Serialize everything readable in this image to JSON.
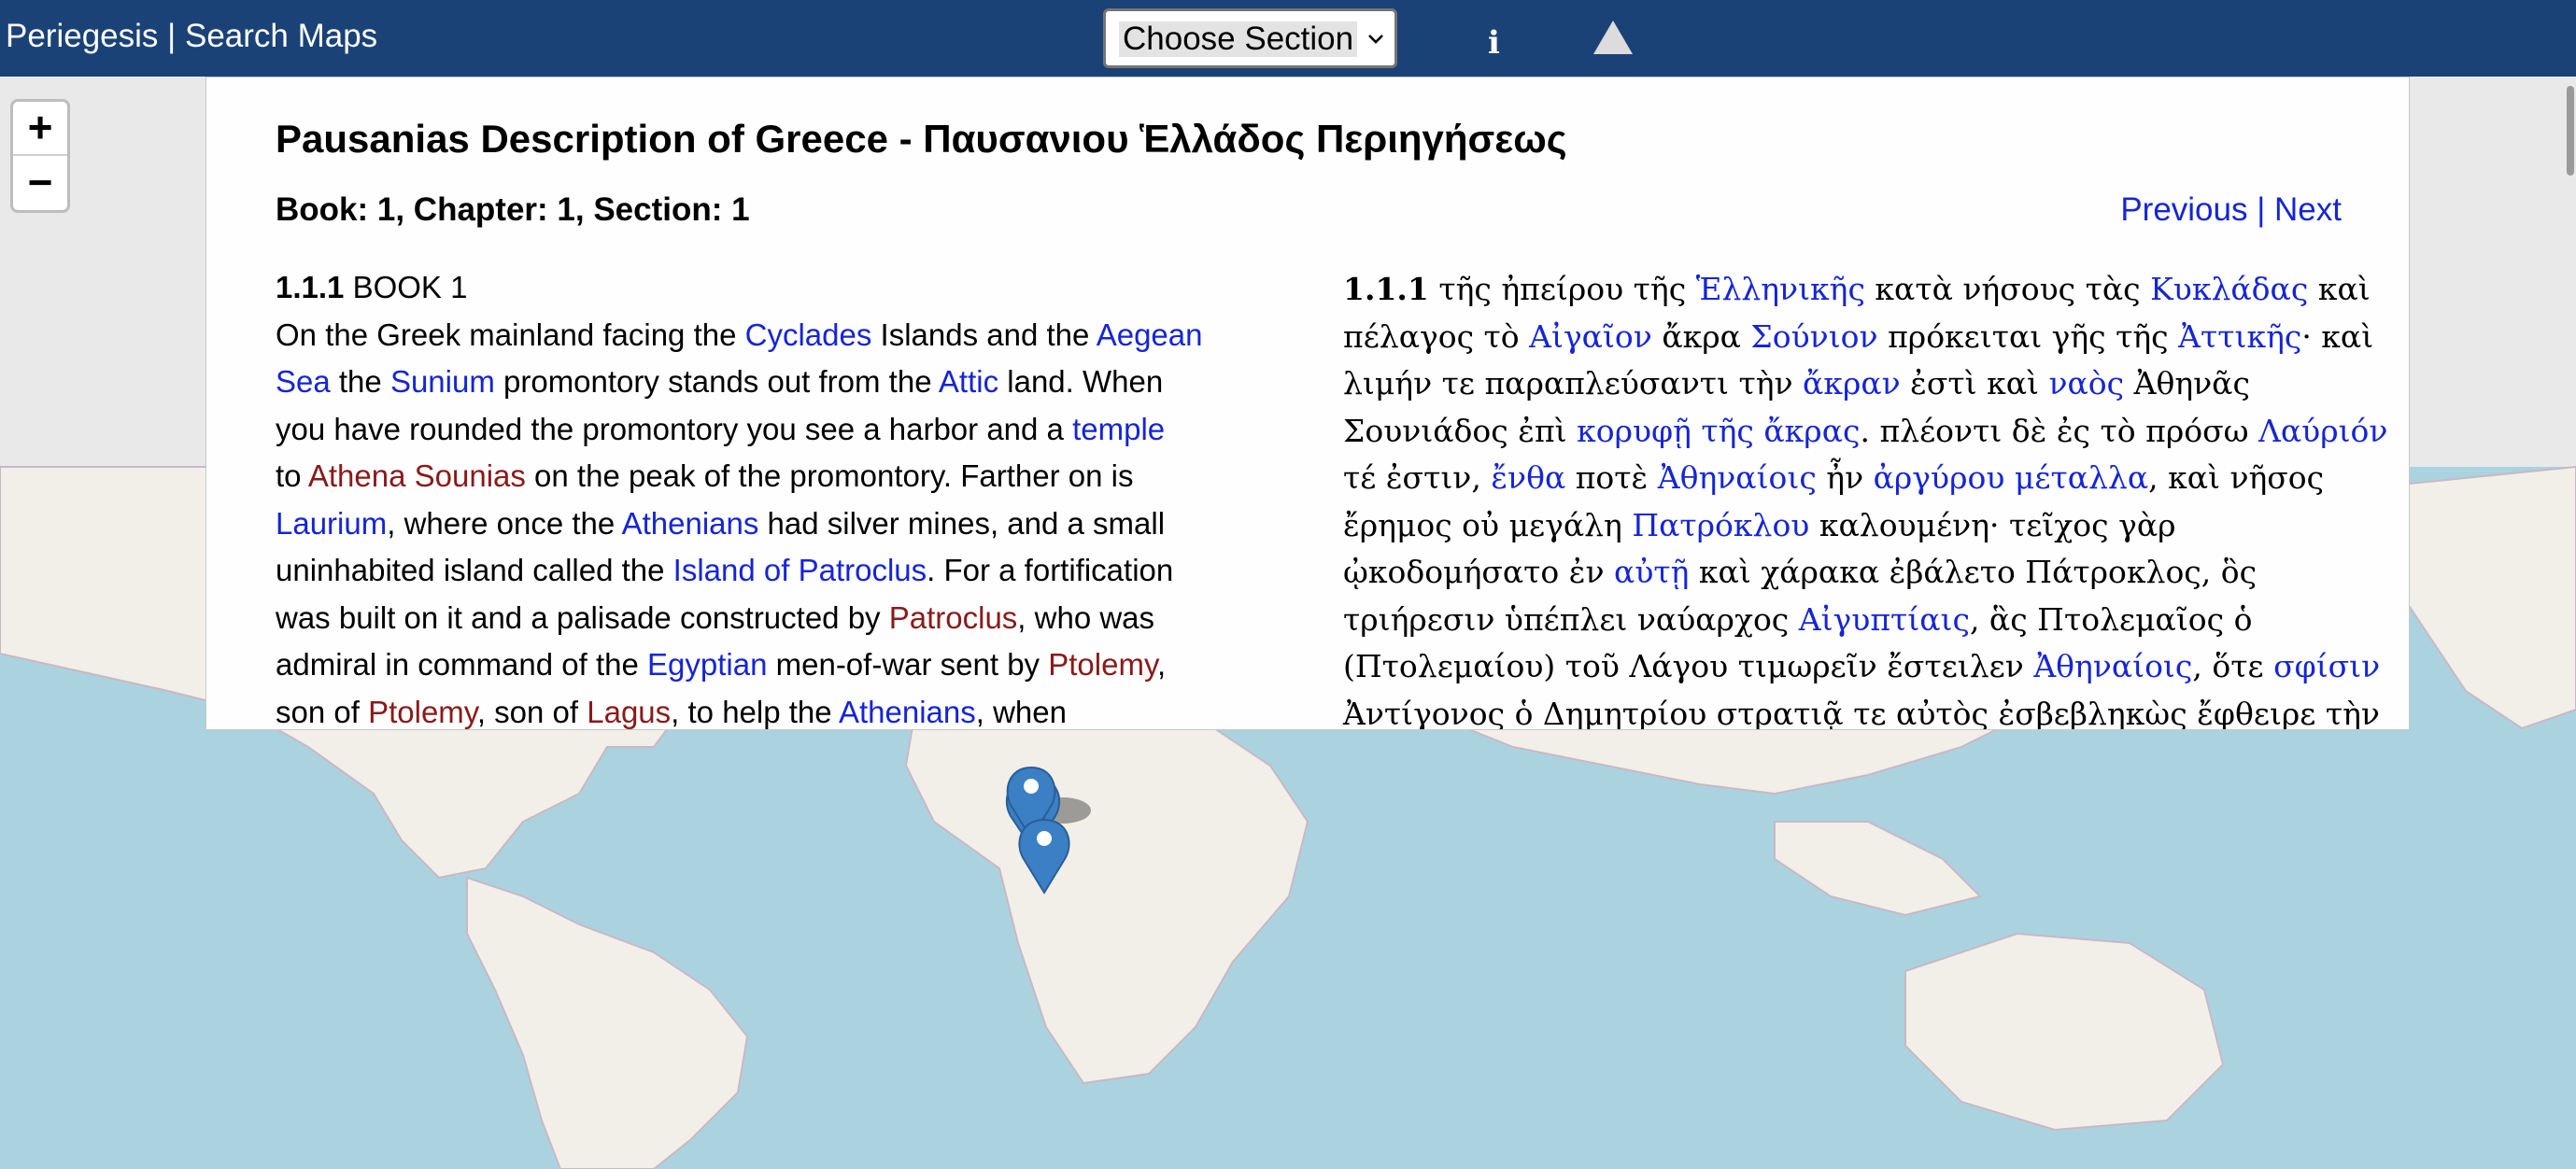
{
  "header": {
    "app_name": "Periegesis",
    "separator": " | ",
    "search_maps": "Search Maps",
    "section_select": "Choose Section",
    "info_icon": "info-icon",
    "up_icon": "triangle-up-icon"
  },
  "zoom": {
    "in": "+",
    "out": "−"
  },
  "panel": {
    "title": "Pausanias Description of Greece - Παυσανιου Ἑλλάδος Περιηγήσεως",
    "citation": "Book: 1, Chapter: 1, Section: 1",
    "pager": {
      "previous": "Previous",
      "separator": " | ",
      "next": "Next"
    },
    "english": {
      "lines": [
        [
          {
            "t": "1.1.1",
            "k": "b"
          },
          {
            "t": " BOOK 1"
          }
        ],
        [
          {
            "t": "On the Greek mainland facing the "
          },
          {
            "t": "Cyclades",
            "k": "place"
          },
          {
            "t": " Islands and the "
          },
          {
            "t": "Aegean",
            "k": "place"
          }
        ],
        [
          {
            "t": "Sea",
            "k": "place"
          },
          {
            "t": " the "
          },
          {
            "t": "Sunium",
            "k": "place"
          },
          {
            "t": " promontory stands out from the "
          },
          {
            "t": "Attic",
            "k": "place"
          },
          {
            "t": " land. When"
          }
        ],
        [
          {
            "t": "you have rounded the promontory you see a harbor and a "
          },
          {
            "t": "temple",
            "k": "place"
          }
        ],
        [
          {
            "t": "to "
          },
          {
            "t": "Athena Sounias",
            "k": "person"
          },
          {
            "t": " on the peak of the promontory. Farther on is"
          }
        ],
        [
          {
            "t": "Laurium",
            "k": "place"
          },
          {
            "t": ", where once the "
          },
          {
            "t": "Athenians",
            "k": "place"
          },
          {
            "t": " had silver mines, and a small"
          }
        ],
        [
          {
            "t": "uninhabited island called the "
          },
          {
            "t": "Island of Patroclus",
            "k": "place"
          },
          {
            "t": ". For a fortification"
          }
        ],
        [
          {
            "t": "was built on it and a palisade constructed by "
          },
          {
            "t": "Patroclus",
            "k": "person"
          },
          {
            "t": ", who was"
          }
        ],
        [
          {
            "t": "admiral in command of the "
          },
          {
            "t": "Egyptian",
            "k": "place"
          },
          {
            "t": " men-of-war sent by "
          },
          {
            "t": "Ptolemy",
            "k": "person"
          },
          {
            "t": ","
          }
        ],
        [
          {
            "t": "son of "
          },
          {
            "t": "Ptolemy",
            "k": "person"
          },
          {
            "t": ", son of "
          },
          {
            "t": "Lagus",
            "k": "person"
          },
          {
            "t": ", to help the "
          },
          {
            "t": "Athenians",
            "k": "place"
          },
          {
            "t": ", when"
          }
        ]
      ]
    },
    "greek": {
      "lines": [
        [
          {
            "t": "1.1.1",
            "k": "b"
          },
          {
            "t": " τῆς ἠπείρου τῆς "
          },
          {
            "t": "Ἑλληνικῆς",
            "k": "place"
          },
          {
            "t": " κατὰ νήσους τὰς "
          },
          {
            "t": "Κυκλάδας",
            "k": "place"
          },
          {
            "t": " καὶ"
          }
        ],
        [
          {
            "t": "πέλαγος τὸ "
          },
          {
            "t": "Αἰγαῖον",
            "k": "place"
          },
          {
            "t": " ἄκρα "
          },
          {
            "t": "Σούνιον",
            "k": "place"
          },
          {
            "t": " πρόκειται γῆς τῆς "
          },
          {
            "t": "Ἀττικῆς",
            "k": "place"
          },
          {
            "t": "· καὶ"
          }
        ],
        [
          {
            "t": "λιμήν τε παραπλεύσαντι τὴν "
          },
          {
            "t": "ἄκραν",
            "k": "place"
          },
          {
            "t": " ἐστὶ καὶ "
          },
          {
            "t": "ναὸς",
            "k": "place"
          },
          {
            "t": " Ἀθηνᾶς"
          }
        ],
        [
          {
            "t": "Σουνιάδος ἐπὶ "
          },
          {
            "t": "κορυφῇ τῆς ἄκρας",
            "k": "place"
          },
          {
            "t": ". πλέοντι δὲ ἐς τὸ πρόσω "
          },
          {
            "t": "Λαύριόν",
            "k": "place"
          }
        ],
        [
          {
            "t": "τέ ἐστιν, "
          },
          {
            "t": "ἔνθα",
            "k": "place"
          },
          {
            "t": " ποτὲ "
          },
          {
            "t": "Ἀθηναίοις",
            "k": "place"
          },
          {
            "t": " ἦν "
          },
          {
            "t": "ἀργύρου μέταλλα",
            "k": "place"
          },
          {
            "t": ", καὶ νῆσος"
          }
        ],
        [
          {
            "t": "ἔρημος οὐ μεγάλη "
          },
          {
            "t": "Πατρόκλου",
            "k": "place"
          },
          {
            "t": " καλουμένη· τεῖχος γὰρ"
          }
        ],
        [
          {
            "t": "ᾠκοδομήσατο ἐν "
          },
          {
            "t": "αὐτῇ",
            "k": "place"
          },
          {
            "t": " καὶ χάρακα ἐβάλετο Πάτροκλος, ὃς"
          }
        ],
        [
          {
            "t": "τριήρεσιν ὑπέπλει ναύαρχος "
          },
          {
            "t": "Αἰγυπτίαις",
            "k": "place"
          },
          {
            "t": ", ἃς Πτολεμαῖος ὁ"
          }
        ],
        [
          {
            "t": "(Πτολεμαίου) τοῦ Λάγου τιμωρεῖν ἔστειλεν "
          },
          {
            "t": "Ἀθηναίοις",
            "k": "place"
          },
          {
            "t": ", ὅτε "
          },
          {
            "t": "σφίσιν",
            "k": "place"
          }
        ],
        [
          {
            "t": "Ἀντίγονος ὁ Δημητρίου στρατιᾷ τε αὐτὸς ἐσβεβληκὼς ἔφθειρε τὴν"
          }
        ]
      ]
    }
  },
  "map": {
    "markers": [
      "map-marker",
      "map-marker"
    ],
    "colors": {
      "ocean": "#aad3df",
      "land": "#f2efe9",
      "border": "#c9b8c6",
      "marker": "#3b7fc4"
    }
  }
}
